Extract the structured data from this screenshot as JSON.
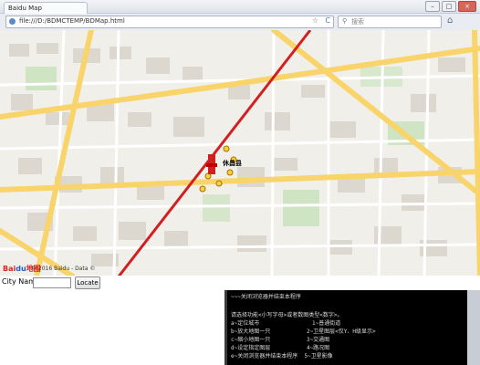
{
  "window": {
    "tab_title": "Baidu Map",
    "min": "–",
    "max": "□",
    "close": "×"
  },
  "navbar": {
    "url": "file:///D:/BDMCTEMP/BDMap.html",
    "search_placeholder": "搜索",
    "star_glyph": "☆",
    "reload_glyph": "C",
    "search_glyph": "⚲",
    "home_glyph": "⌂"
  },
  "map": {
    "marker_label": "休昌县",
    "logo_main": "Bai",
    "logo_accent": "du",
    "logo_tail": "地图",
    "copyright": "© 2016 Baidu - Data ©"
  },
  "form": {
    "city_label": "City Name:",
    "locate_button": "Locate"
  },
  "console": {
    "lines": [
      "~~~关闭浏览器并结束本程序",
      "",
      "请选择功能<小写字母>或者数图类型<数字>。",
      "a~定位城市                1~普通街道",
      "b~放大地图一只           2~卫星图层<仅Y、H级显示>",
      "c~缩小地图一只           3~交通图",
      "d~设定指定图层           4~路况图",
      "e~关闭浏览器并结束本程序  5~卫星影像"
    ]
  }
}
